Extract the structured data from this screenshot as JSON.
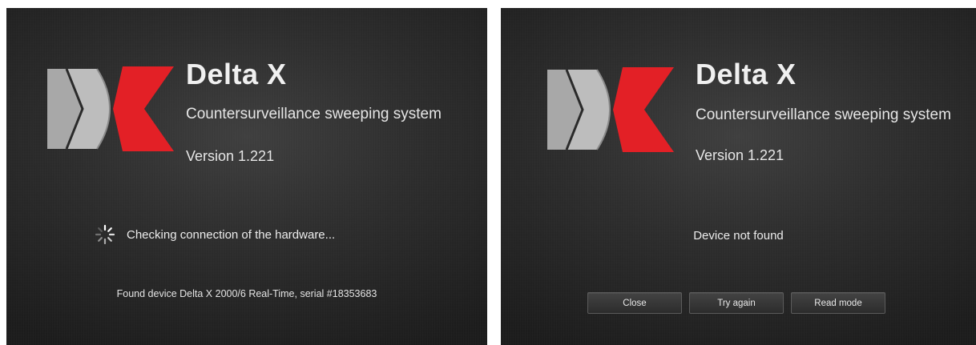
{
  "colors": {
    "logo_gray": "#a6a6a6",
    "logo_red": "#e32026",
    "panel_bg": "#2e2e2e",
    "text": "#f0f0f0"
  },
  "screens": [
    {
      "name": "checking",
      "title": "Delta X",
      "subtitle": "Countersurveillance sweeping system",
      "version": "Version 1.221",
      "status": "Checking connection of the hardware...",
      "status_icon": "loading-spinner-icon",
      "found_device": "Found device Delta X 2000/6 Real-Time, serial #18353683"
    },
    {
      "name": "not-found",
      "title": "Delta X",
      "subtitle": "Countersurveillance sweeping system",
      "version": "Version 1.221",
      "status": "Device not found",
      "buttons": {
        "close": "Close",
        "try_again": "Try again",
        "read_mode": "Read mode"
      }
    }
  ]
}
